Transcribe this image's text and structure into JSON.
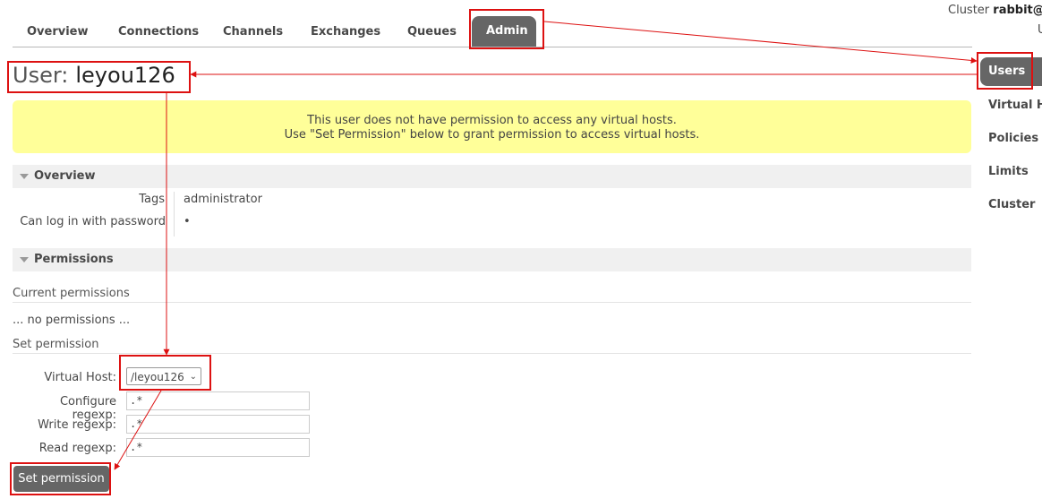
{
  "nav": {
    "tabs": [
      "Overview",
      "Connections",
      "Channels",
      "Exchanges",
      "Queues",
      "Admin"
    ],
    "active_tab": "Admin"
  },
  "cluster": {
    "label": "Cluster",
    "name": "rabbit@D",
    "sub": "U"
  },
  "page": {
    "title_prefix": "User:",
    "user_name": "leyou126"
  },
  "warning": {
    "line1": "This user does not have permission to access any virtual hosts.",
    "line2": "Use \"Set Permission\" below to grant permission to access virtual hosts."
  },
  "overview": {
    "header": "Overview",
    "tags_label": "Tags",
    "tags_value": "administrator",
    "password_label": "Can log in with password",
    "password_value": "•"
  },
  "permissions": {
    "header": "Permissions",
    "current_label": "Current permissions",
    "none_text": "... no permissions ...",
    "set_label": "Set permission",
    "vhost_label": "Virtual Host:",
    "vhost_value": "/leyou126",
    "configure_label": "Configure regexp:",
    "configure_value": ".*",
    "write_label": "Write regexp:",
    "write_value": ".*",
    "read_label": "Read regexp:",
    "read_value": ".*",
    "submit_label": "Set permission"
  },
  "sidebar": {
    "items": [
      "Users",
      "Virtual Ho",
      "Policies",
      "Limits",
      "Cluster"
    ],
    "active": "Users"
  },
  "colors": {
    "accent_dark": "#666666",
    "warning_bg": "#ffff99",
    "annotation_red": "#dd1111"
  }
}
